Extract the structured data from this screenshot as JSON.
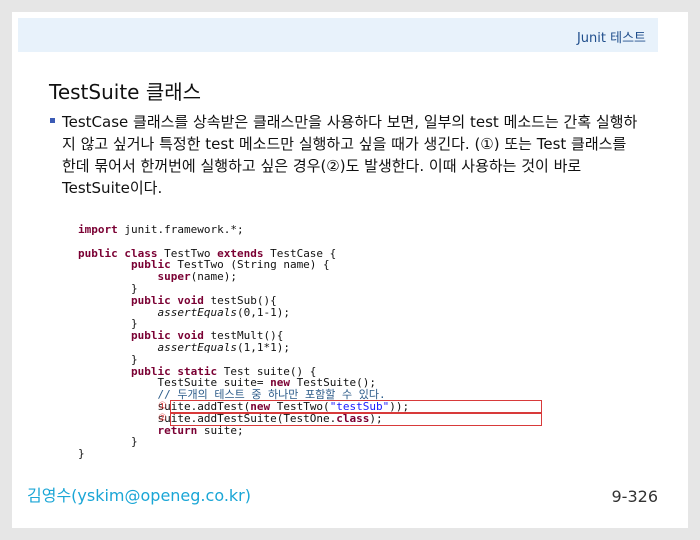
{
  "header": {
    "brand": "Junit 테스트"
  },
  "slide": {
    "title": "TestSuite 클래스",
    "paragraph": "TestCase 클래스를 상속받은 클래스만을 사용하다 보면, 일부의 test 메소드는 간혹 실행하지 않고 싶거나 특정한 test 메소드만 실행하고 싶을 때가 생긴다. (①) 또는 Test 클래스를 한데 묶어서 한꺼번에 실행하고 싶은 경우(②)도 발생한다. 이때 사용하는 것이 바로 TestSuite이다."
  },
  "code": {
    "l1_kw": "import",
    "l1_rest": " junit.framework.*;",
    "l3_kw1": "public class",
    "l3_mid": " TestTwo ",
    "l3_kw2": "extends",
    "l3_rest": " TestCase {",
    "l4_kw": "public",
    "l4_rest": " TestTwo (String name) {",
    "l5_kw": "super",
    "l5_rest": "(name);",
    "l6": "}",
    "l7_kw": "public void",
    "l7_rest": " testSub(){",
    "l8_it": "assertEquals",
    "l8_rest": "(0,1-1);",
    "l9": "}",
    "l10_kw": "public void",
    "l10_rest": " testMult(){",
    "l11_it": "assertEquals",
    "l11_rest": "(1,1*1);",
    "l12": "}",
    "l13_kw": "public static",
    "l13_rest": " Test suite() {",
    "l14_a": "TestSuite suite= ",
    "l14_kw": "new",
    "l14_b": " TestSuite();",
    "l15_cmt": "// 두개의 테스트 중 하나만 포함할 수 있다.",
    "l16_a": "suite.addTest(",
    "l16_kw": "new",
    "l16_b": " TestTwo(",
    "l16_str": "\"testSub\"",
    "l16_c": "));",
    "l17_a": "suite.addTestSuite(TestOne.",
    "l17_kw": "class",
    "l17_b": ");",
    "l18_kw": "return",
    "l18_rest": " suite;",
    "l19": "}",
    "l20": "}",
    "marker1": "①",
    "marker2": "②"
  },
  "footer": {
    "signature": "김영수(yskim@openeg.co.kr)",
    "page_number": "9-326"
  }
}
